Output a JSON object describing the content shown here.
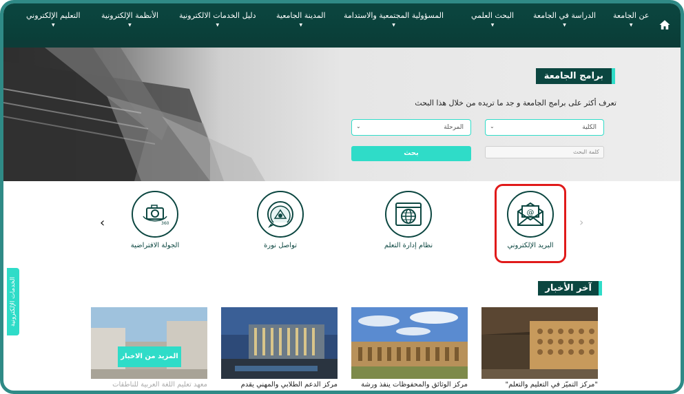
{
  "nav": {
    "home_icon": "home-icon",
    "items": [
      {
        "label": "عن الجامعة"
      },
      {
        "label": "الدراسة في الجامعة"
      },
      {
        "label": "البحث العلمي"
      },
      {
        "label": "المسؤولية المجتمعية والاستدامة"
      },
      {
        "label": "المدينة الجامعية"
      },
      {
        "label": "دليل الخدمات الالكترونية"
      },
      {
        "label": "الأنظمة الإلكترونية"
      },
      {
        "label": "التعليم الإلكتروني"
      }
    ]
  },
  "programs": {
    "title": "برامج الجامعة",
    "subtitle": "تعرف أكثر على برامج الجامعة و جد ما تريده من خلال هذا البحث",
    "college_select": "الكلية",
    "stage_select": "المرحلة",
    "search_placeholder": "كلمة البحث",
    "search_button": "بحث"
  },
  "services": [
    {
      "label": "البريد الإلكتروني",
      "icon": "email-icon"
    },
    {
      "label": "نظام إدارة التعلم",
      "icon": "globe-browser-icon"
    },
    {
      "label": "تواصل نورة",
      "icon": "university-logo-icon"
    },
    {
      "label": "الجولة الافتراضية",
      "icon": "camera-360-icon"
    }
  ],
  "side_tab": "الخدمات الإلكترونية",
  "news": {
    "title": "آخر الأخبار",
    "more_button": "المزيد من الاخبار",
    "items": [
      {
        "caption": "\"مركز التميّز في التعليم والتعلّم\""
      },
      {
        "caption": "مركز الوثائق والمحفوظات ينفذ ورشة"
      },
      {
        "caption": "مركز الدعم الطلابي والمهني يقدم"
      },
      {
        "caption": "معهد تعليم اللغة العربية للناطقات"
      }
    ]
  },
  "colors": {
    "primary": "#0b4640",
    "accent": "#2fdcc8",
    "highlight": "#e01a1a",
    "frame": "#2f8a86"
  }
}
